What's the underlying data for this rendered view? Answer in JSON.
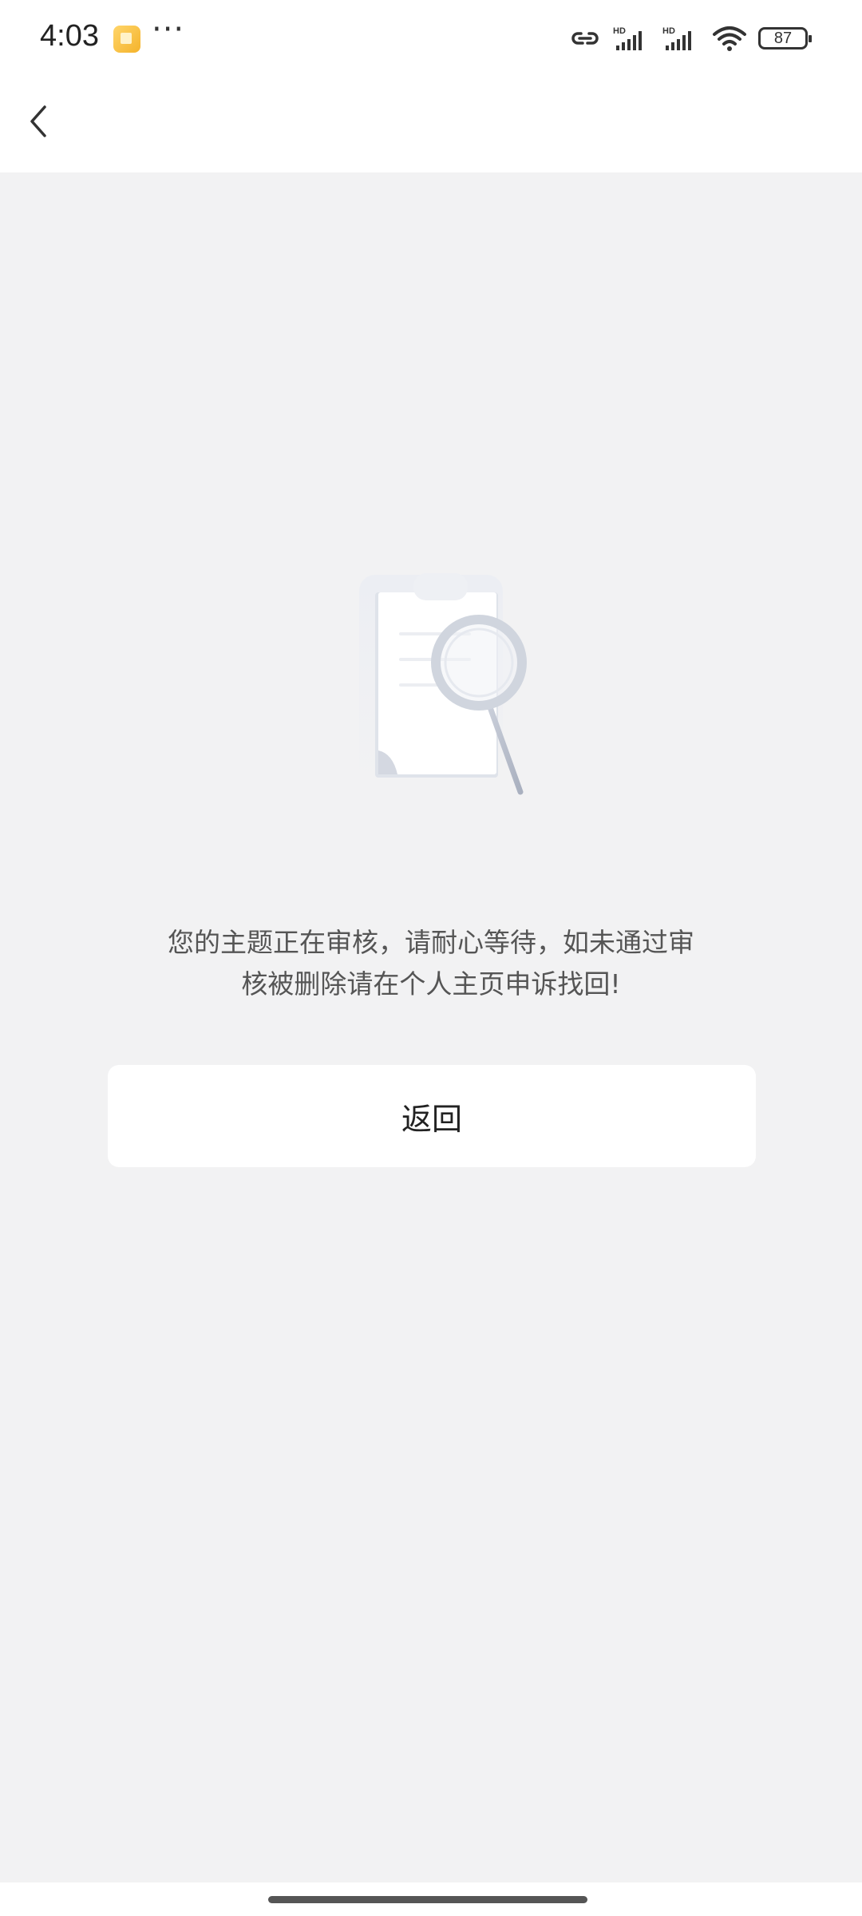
{
  "status_bar": {
    "time": "4:03",
    "more_indicator": "···",
    "battery_level": "87",
    "icons": [
      "notification-app-icon",
      "link-icon",
      "hd-signal-icon",
      "hd-signal-icon",
      "wifi-icon",
      "battery-icon"
    ]
  },
  "nav": {
    "back_icon": "chevron-left-icon"
  },
  "empty_state": {
    "illustration_icon": "clipboard-search-icon",
    "message_line1": "您的主题正在审核，请耐心等待，如未通过审",
    "message_line2": "核被删除请在个人主页申诉找回!"
  },
  "actions": {
    "return_label": "返回"
  },
  "colors": {
    "background": "#f2f2f3",
    "surface": "#ffffff",
    "text_primary": "#222222",
    "text_secondary": "#555555"
  }
}
